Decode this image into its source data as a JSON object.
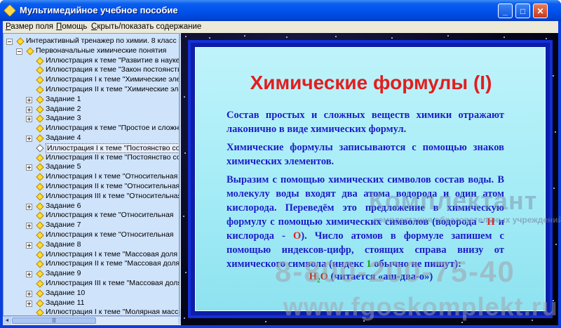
{
  "window": {
    "title": "Мультимедийное учебное пособие",
    "controls": {
      "minimize": "_",
      "maximize": "□",
      "close": "✕"
    }
  },
  "menu": [
    {
      "pre": "",
      "key": "Р",
      "post": "азмер поля"
    },
    {
      "pre": "",
      "key": "П",
      "post": "омощь"
    },
    {
      "pre": "",
      "key": "С",
      "post": "крыть/показать содержание"
    }
  ],
  "tree": {
    "items": [
      {
        "label": "Интерактивный тренажер по химии. 8 класс",
        "level": 0,
        "expander": "minus",
        "icon": "node"
      },
      {
        "label": "Первоначальные химические понятия",
        "level": 1,
        "expander": "minus",
        "icon": "node"
      },
      {
        "label": "Иллюстрация к теме \"Развитие в науке",
        "level": 2,
        "expander": "",
        "icon": "node"
      },
      {
        "label": "Иллюстрация к теме \"Закон постоянства",
        "level": 2,
        "expander": "",
        "icon": "node"
      },
      {
        "label": "Иллюстрация I к теме \"Химические элементы",
        "level": 2,
        "expander": "",
        "icon": "node"
      },
      {
        "label": "Иллюстрация II к теме \"Химические элементы",
        "level": 2,
        "expander": "",
        "icon": "node"
      },
      {
        "label": "Задание 1",
        "level": 2,
        "expander": "plus",
        "icon": "node"
      },
      {
        "label": "Задание 2",
        "level": 2,
        "expander": "plus",
        "icon": "node"
      },
      {
        "label": "Задание 3",
        "level": 2,
        "expander": "plus",
        "icon": "node"
      },
      {
        "label": "Иллюстрация к теме \"Простое и сложное",
        "level": 2,
        "expander": "",
        "icon": "node"
      },
      {
        "label": "Задание 4",
        "level": 2,
        "expander": "plus",
        "icon": "node"
      },
      {
        "label": "Иллюстрация I к теме \"Постоянство состава",
        "level": 2,
        "expander": "",
        "icon": "open",
        "selected": true
      },
      {
        "label": "Иллюстрация II к теме \"Постоянство состава",
        "level": 2,
        "expander": "",
        "icon": "node"
      },
      {
        "label": "Задание 5",
        "level": 2,
        "expander": "plus",
        "icon": "node"
      },
      {
        "label": "Иллюстрация I к теме \"Относительная",
        "level": 2,
        "expander": "",
        "icon": "node"
      },
      {
        "label": "Иллюстрация II к теме \"Относительная",
        "level": 2,
        "expander": "",
        "icon": "node"
      },
      {
        "label": "Иллюстрация III к теме \"Относительная",
        "level": 2,
        "expander": "",
        "icon": "node"
      },
      {
        "label": "Задание 6",
        "level": 2,
        "expander": "plus",
        "icon": "node"
      },
      {
        "label": "Иллюстрация к теме \"Относительная",
        "level": 2,
        "expander": "",
        "icon": "node"
      },
      {
        "label": "Задание 7",
        "level": 2,
        "expander": "plus",
        "icon": "node"
      },
      {
        "label": "Иллюстрация к теме \"Относительная",
        "level": 2,
        "expander": "",
        "icon": "node"
      },
      {
        "label": "Задание 8",
        "level": 2,
        "expander": "plus",
        "icon": "node"
      },
      {
        "label": "Иллюстрация I к теме \"Массовая доля",
        "level": 2,
        "expander": "",
        "icon": "node"
      },
      {
        "label": "Иллюстрация II к теме \"Массовая доля",
        "level": 2,
        "expander": "",
        "icon": "node"
      },
      {
        "label": "Задание 9",
        "level": 2,
        "expander": "plus",
        "icon": "node"
      },
      {
        "label": "Иллюстрация III к теме \"Массовая доля",
        "level": 2,
        "expander": "",
        "icon": "node"
      },
      {
        "label": "Задание 10",
        "level": 2,
        "expander": "plus",
        "icon": "node"
      },
      {
        "label": "Задание 11",
        "level": 2,
        "expander": "plus",
        "icon": "node"
      },
      {
        "label": "Иллюстрация I к теме \"Молярная масса",
        "level": 2,
        "expander": "",
        "icon": "node"
      }
    ],
    "hscroll_grip": "|||"
  },
  "slide": {
    "title": "Химические формулы (I)",
    "p1": "Состав простых и сложных веществ химики отражают лаконично в виде химических формул.",
    "p2": "Химические формулы записываются с помощью знаков химических элементов.",
    "p3": {
      "a": "Выразим с помощью химических символов состав воды. В молекулу воды входят два атома водорода и один атом кислорода. Переведём это предложение в химическую формулу с помощью химических символов (водорода - ",
      "h": "Н",
      "b": " и кислорода - ",
      "o": "О",
      "c": "). Число атомов в формуле запишем с помощью индексов-цифр, стоящих справа внизу от химического символа (индекс ",
      "one": "1",
      "d": " обычно не пишут):"
    },
    "formula": {
      "h": "Н",
      "sub": "2",
      "o": "О",
      "reading": " (читается «аш-два-о»)"
    }
  },
  "watermark": {
    "brand": "Комплектант",
    "sub": "комплектация образовательных учреждений",
    "phone": "8-800-200-75-40",
    "site": "www.fgoskomplekt.ru"
  },
  "colors": {
    "title_bar": "#0050ea",
    "tree_bg": "#cfe3fb",
    "slide_bg": "#a4ecf6",
    "slide_title": "#e21e1e",
    "slide_text": "#1c1cc8"
  }
}
